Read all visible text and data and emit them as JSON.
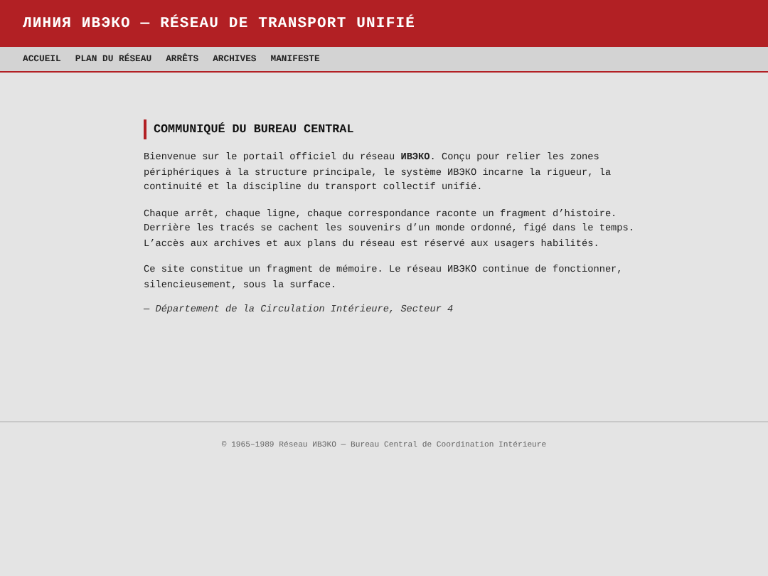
{
  "header": {
    "title": "ЛИНИЯ ИВЭКО — RÉSEAU DE TRANSPORT UNIFIÉ"
  },
  "nav": [
    {
      "label": "ACCUEIL"
    },
    {
      "label": "PLAN DU RÉSEAU"
    },
    {
      "label": "ARRÊTS"
    },
    {
      "label": "ARCHIVES"
    },
    {
      "label": "MANIFESTE"
    }
  ],
  "article": {
    "heading": "COMMUNIQUÉ DU BUREAU CENTRAL",
    "paragraphs": [
      "Bienvenue sur le portail officiel du réseau **ИВЭКО**. Conçu pour relier les zones périphériques à la structure principale, le système ИВЭКО incarne la rigueur, la continuité et la discipline du transport collectif unifié.",
      "Chaque arrêt, chaque ligne, chaque correspondance raconte un fragment d’histoire. Derrière les tracés se cachent les souvenirs d’un monde ordonné, figé dans le temps. L’accès aux archives et aux plans du réseau est réservé aux usagers habilités.",
      "Ce site constitue un fragment de mémoire. Le réseau ИВЭКО continue de fonctionner, silencieusement, sous la surface."
    ],
    "signature": "— Département de la Circulation Intérieure, Secteur 4"
  },
  "footer": {
    "text": "© 1965–1989 Réseau ИВЭКО — Bureau Central de Coordination Intérieure"
  }
}
